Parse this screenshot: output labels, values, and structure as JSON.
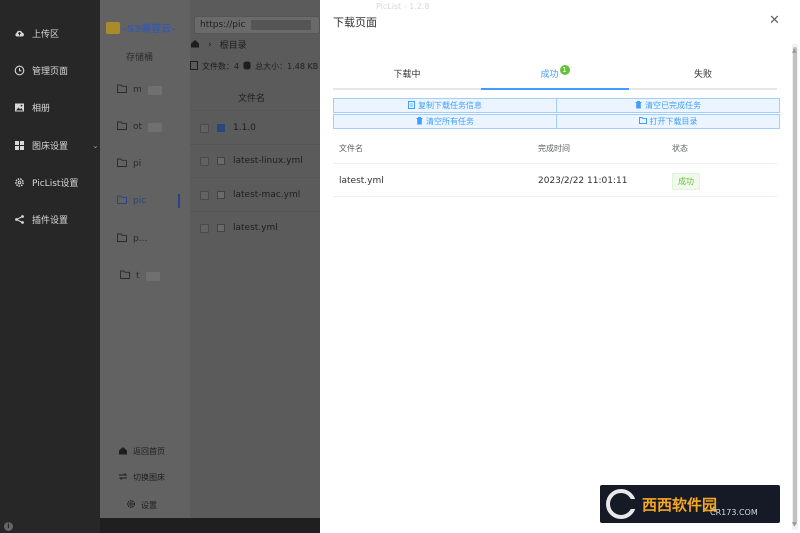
{
  "sidebar": {
    "items": [
      {
        "label": "上传区",
        "icon": "cloud-upload-icon"
      },
      {
        "label": "管理页面",
        "icon": "clock-icon"
      },
      {
        "label": "相册",
        "icon": "image-icon"
      },
      {
        "label": "图床设置",
        "icon": "grid-icon"
      },
      {
        "label": "PicList设置",
        "icon": "gear-icon"
      },
      {
        "label": "插件设置",
        "icon": "share-icon"
      }
    ]
  },
  "manager": {
    "logo_text": "-S3兼容云-",
    "bucket_title": "存储桶",
    "buckets": [
      {
        "label": "m"
      },
      {
        "label": "ot"
      },
      {
        "label": "pi"
      },
      {
        "label": "pic"
      },
      {
        "label": "p..."
      },
      {
        "label": "t"
      }
    ],
    "bottom_links": {
      "home": "返回首页",
      "switch": "切换图床",
      "settings": "设置"
    },
    "url_value": "https://pic",
    "breadcrumb_root": "根目录",
    "file_count_label": "文件数：4",
    "total_size_label": "总大小：1.48 KB",
    "file_name_header": "文件名",
    "files": [
      "1.1.0",
      "latest-linux.yml",
      "latest-mac.yml",
      "latest.yml"
    ]
  },
  "dialog": {
    "subtitle": "PicList - 1.2.8",
    "title": "下载页面",
    "tabs": {
      "downloading": "下载中",
      "success": "成功",
      "success_count": "1",
      "failed": "失败"
    },
    "actions": {
      "copy_info": "复制下载任务信息",
      "clear_done": "清空已完成任务",
      "clear_all": "清空所有任务",
      "open_dir": "打开下载目录"
    },
    "table": {
      "headers": {
        "name": "文件名",
        "time": "完成时间",
        "status": "状态"
      },
      "rows": [
        {
          "name": "latest.yml",
          "time": "2023/2/22 11:01:11",
          "status": "成功"
        }
      ]
    }
  },
  "watermark": {
    "text": "西西软件园",
    "sub": "CR173.COM"
  },
  "colors": {
    "accent": "#409eff",
    "success": "#67c23a",
    "sidebar_bg": "#272727"
  }
}
